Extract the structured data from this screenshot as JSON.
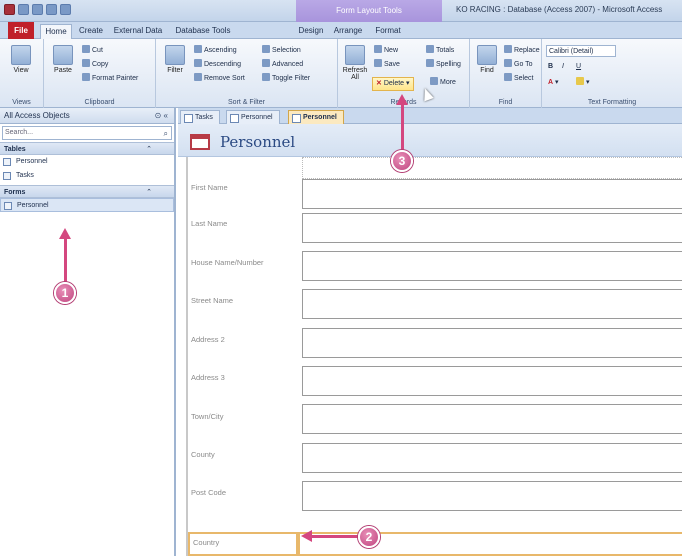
{
  "window": {
    "title": "KO RACING : Database (Access 2007) - Microsoft Access",
    "context_tools": "Form Layout Tools"
  },
  "ribbon_tabs": [
    "File",
    "Home",
    "Create",
    "External Data",
    "Database Tools",
    "Design",
    "Arrange",
    "Format"
  ],
  "ribbon": {
    "views": {
      "view": "View",
      "label": "Views"
    },
    "clipboard": {
      "paste": "Paste",
      "cut": "Cut",
      "copy": "Copy",
      "format_painter": "Format Painter",
      "label": "Clipboard"
    },
    "sort_filter": {
      "filter": "Filter",
      "ascending": "Ascending",
      "descending": "Descending",
      "remove_sort": "Remove Sort",
      "selection": "Selection",
      "advanced": "Advanced",
      "toggle_filter": "Toggle Filter",
      "label": "Sort & Filter"
    },
    "records": {
      "refresh": "Refresh All",
      "new": "New",
      "save": "Save",
      "delete": "Delete",
      "totals": "Totals",
      "spelling": "Spelling",
      "more": "More",
      "label": "Records"
    },
    "find": {
      "find": "Find",
      "replace": "Replace",
      "goto": "Go To",
      "select": "Select",
      "label": "Find"
    },
    "text_formatting": {
      "font": "Calibri (Detail)",
      "bold": "B",
      "italic": "I",
      "underline": "U",
      "label": "Text Formatting"
    }
  },
  "nav": {
    "header": "All Access Objects",
    "header_controls": "«",
    "search_placeholder": "Search...",
    "groups": [
      {
        "name": "Tables",
        "items": [
          "Personnel",
          "Tasks"
        ]
      },
      {
        "name": "Forms",
        "items": [
          "Personnel"
        ]
      }
    ]
  },
  "doc_tabs": [
    "Tasks",
    "Personnel",
    "Personnel"
  ],
  "form": {
    "title": "Personnel",
    "fields": [
      {
        "label": "First Name",
        "value": ""
      },
      {
        "label": "Last Name",
        "value": ""
      },
      {
        "label": "House Name/Number",
        "value": ""
      },
      {
        "label": "Street Name",
        "value": ""
      },
      {
        "label": "Address 2",
        "value": ""
      },
      {
        "label": "Address 3",
        "value": ""
      },
      {
        "label": "Town/City",
        "value": ""
      },
      {
        "label": "County",
        "value": ""
      },
      {
        "label": "Post Code",
        "value": ""
      },
      {
        "label": "Country",
        "value": ""
      }
    ]
  },
  "callouts": [
    "1",
    "2",
    "3"
  ],
  "colors": {
    "callout": "#c0457f",
    "file_tab": "#c0202a",
    "highlight": "#e8b86b",
    "form_title": "#2b4a83"
  }
}
